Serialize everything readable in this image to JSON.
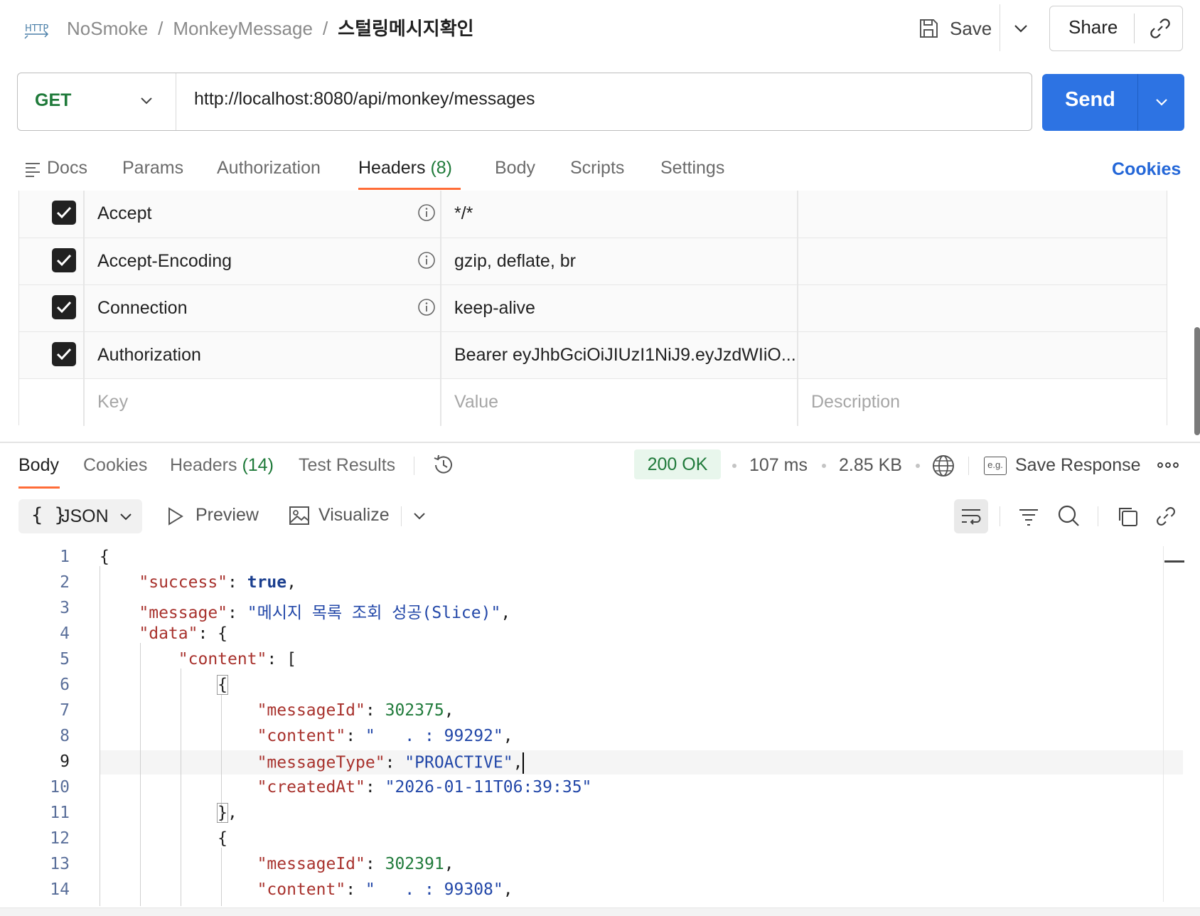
{
  "app": {
    "icon_label": "HTTP",
    "breadcrumb": [
      "NoSmoke",
      "MonkeyMessage",
      "스털링메시지확인"
    ],
    "save_label": "Save",
    "share_label": "Share"
  },
  "request": {
    "method": "GET",
    "url": "http://localhost:8080/api/monkey/messages",
    "send_label": "Send"
  },
  "request_tabs": {
    "docs": "Docs",
    "params": "Params",
    "authorization": "Authorization",
    "headers": "Headers",
    "headers_count": "(8)",
    "body": "Body",
    "scripts": "Scripts",
    "settings": "Settings",
    "cookies": "Cookies"
  },
  "headers_table": {
    "rows": [
      {
        "key": "Accept",
        "value": "*/*",
        "checked": true,
        "info": true
      },
      {
        "key": "Accept-Encoding",
        "value": "gzip, deflate, br",
        "checked": true,
        "info": true
      },
      {
        "key": "Connection",
        "value": "keep-alive",
        "checked": true,
        "info": true
      },
      {
        "key": "Authorization",
        "value": "Bearer eyJhbGciOiJIUzI1NiJ9.eyJzdWIiO...",
        "checked": true,
        "info": false
      }
    ],
    "placeholder": {
      "key": "Key",
      "value": "Value",
      "description": "Description"
    }
  },
  "response_tabs": {
    "body": "Body",
    "cookies": "Cookies",
    "headers": "Headers",
    "headers_count": "(14)",
    "test_results": "Test Results"
  },
  "response_meta": {
    "status": "200 OK",
    "time": "107 ms",
    "size": "2.85 KB",
    "save_response": "Save Response"
  },
  "response_toolbar": {
    "format": "JSON",
    "format_icon": "{ }",
    "preview": "Preview",
    "visualize": "Visualize"
  },
  "code_lines": [
    "1",
    "2",
    "3",
    "4",
    "5",
    "6",
    "7",
    "8",
    "9",
    "10",
    "11",
    "12",
    "13",
    "14"
  ],
  "code": {
    "l1": "{",
    "success_key": "\"success\"",
    "success_val": "true",
    "message_key": "\"message\"",
    "message_val": "\"메시지 목록 조회 성공(Slice)\"",
    "data_key": "\"data\"",
    "content_key": "\"content\"",
    "m1_id_key": "\"messageId\"",
    "m1_id_val": "302375",
    "m1_content_key": "\"content\"",
    "m1_content_val": "\"   . : 99292\"",
    "m1_type_key": "\"messageType\"",
    "m1_type_val": "\"PROACTIVE\"",
    "m1_created_key": "\"createdAt\"",
    "m1_created_val": "\"2026-01-11T06:39:35\"",
    "m2_id_key": "\"messageId\"",
    "m2_id_val": "302391",
    "m2_content_key": "\"content\"",
    "m2_content_val": "\"   . : 99308\""
  },
  "colors": {
    "accent_orange": "#ff6c37",
    "send_blue": "#2d73e3",
    "method_green": "#1f7a3a",
    "json_key": "#a8322d",
    "json_string": "#2247a8"
  },
  "icons": [
    "http-icon",
    "save-icon",
    "chevron-down-icon",
    "link-icon",
    "docs-icon",
    "info-icon",
    "checkbox-checked-icon",
    "history-icon",
    "globe-icon",
    "example-icon",
    "more-icon",
    "play-icon",
    "image-icon",
    "wrap-icon",
    "filter-icon",
    "search-icon",
    "copy-icon"
  ]
}
